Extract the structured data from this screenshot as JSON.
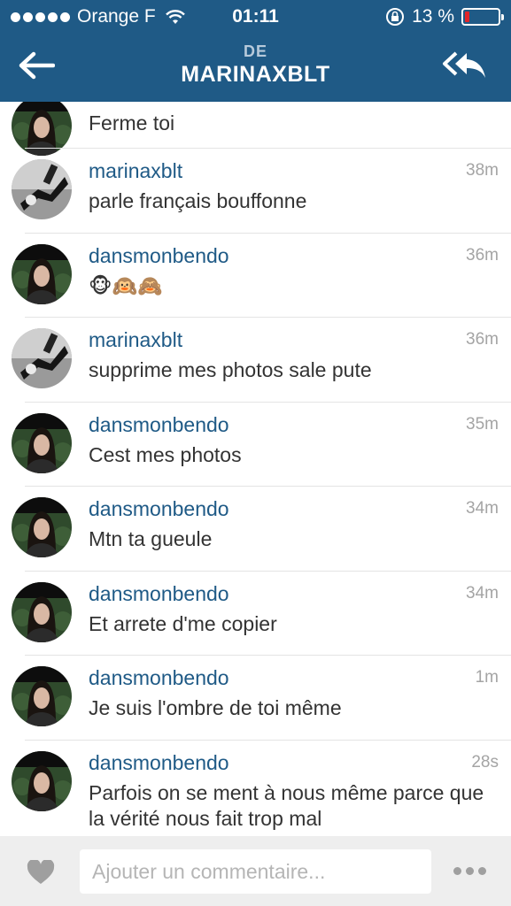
{
  "status_bar": {
    "carrier": "Orange F",
    "time": "01:11",
    "battery_percent": "13 %",
    "battery_level": 0.13,
    "battery_color": "#e0262a",
    "signal_dots": 5
  },
  "header": {
    "small_label": "DE",
    "title": "MARINAXBLT",
    "back_icon": "arrow-left-icon",
    "reply_icon": "reply-all-icon",
    "bg_color": "#1f5a86"
  },
  "messages": [
    {
      "user": "",
      "text": "Ferme toi",
      "time": "",
      "avatar": "dansmonbendo"
    },
    {
      "user": "marinaxblt",
      "text": "parle français bouffonne",
      "time": "38m",
      "avatar": "marinaxblt"
    },
    {
      "user": "dansmonbendo",
      "text": "🐵🙉🙈",
      "time": "36m",
      "avatar": "dansmonbendo"
    },
    {
      "user": "marinaxblt",
      "text": "supprime mes photos sale pute",
      "time": "36m",
      "avatar": "marinaxblt"
    },
    {
      "user": "dansmonbendo",
      "text": "Cest mes photos",
      "time": "35m",
      "avatar": "dansmonbendo"
    },
    {
      "user": "dansmonbendo",
      "text": "Mtn ta gueule",
      "time": "34m",
      "avatar": "dansmonbendo"
    },
    {
      "user": "dansmonbendo",
      "text": "Et arrete d'me copier",
      "time": "34m",
      "avatar": "dansmonbendo"
    },
    {
      "user": "dansmonbendo",
      "text": "Je suis l'ombre de toi même",
      "time": "1m",
      "avatar": "dansmonbendo"
    },
    {
      "user": "dansmonbendo",
      "text": "Parfois on se ment à nous même parce que la vérité nous fait trop mal",
      "time": "28s",
      "avatar": "dansmonbendo"
    }
  ],
  "footer": {
    "comment_placeholder": "Ajouter un commentaire...",
    "comment_value": "",
    "like_icon": "heart-icon",
    "more_icon": "more-options-icon"
  }
}
